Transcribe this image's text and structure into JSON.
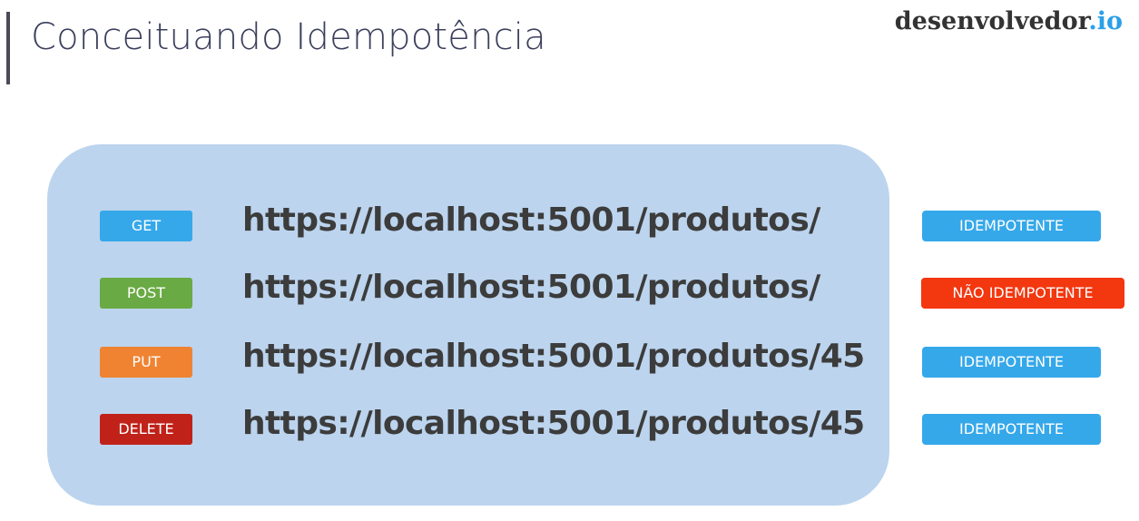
{
  "header": {
    "title": "Conceituando Idempotência",
    "brand_name": "desenvolvedor",
    "brand_tld": ".io"
  },
  "rows": [
    {
      "method": "GET",
      "url": "https://localhost:5001/produtos/",
      "status": "IDEMPOTENTE",
      "method_color": "#35a8ea",
      "status_color": "#35a8ea"
    },
    {
      "method": "POST",
      "url": "https://localhost:5001/produtos/",
      "status": "NÃO IDEMPOTENTE",
      "method_color": "#6aaa44",
      "status_color": "#f3370f"
    },
    {
      "method": "PUT",
      "url": "https://localhost:5001/produtos/45",
      "status": "IDEMPOTENTE",
      "method_color": "#ef8332",
      "status_color": "#35a8ea"
    },
    {
      "method": "DELETE",
      "url": "https://localhost:5001/produtos/45",
      "status": "IDEMPOTENTE",
      "method_color": "#c0221a",
      "status_color": "#35a8ea"
    }
  ],
  "colors": {
    "panel": "#bcd4ee",
    "brand_accent": "#2aa0e8",
    "title": "#3b3f5c"
  }
}
